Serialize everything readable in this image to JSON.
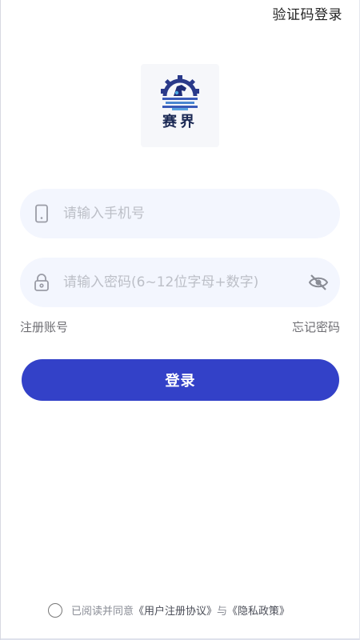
{
  "header": {
    "sms_login": "验证码登录"
  },
  "logo": {
    "text": "赛界"
  },
  "form": {
    "phone_placeholder": "请输入手机号",
    "password_placeholder": "请输入密码(6~12位字母+数字)",
    "register": "注册账号",
    "forgot": "忘记密码",
    "login_button": "登录"
  },
  "agreement": {
    "prefix": "已阅读并同意",
    "user_agreement": "《用户注册协议》",
    "and": "与",
    "privacy": "《隐私政策》"
  },
  "colors": {
    "primary": "#3341c8",
    "field_bg": "#f3f6fe",
    "placeholder": "#bcbfc7"
  },
  "icons": {
    "phone": "phone-icon",
    "lock": "lock-icon",
    "eye_off": "eye-off-icon",
    "logo": "logo-icon"
  }
}
